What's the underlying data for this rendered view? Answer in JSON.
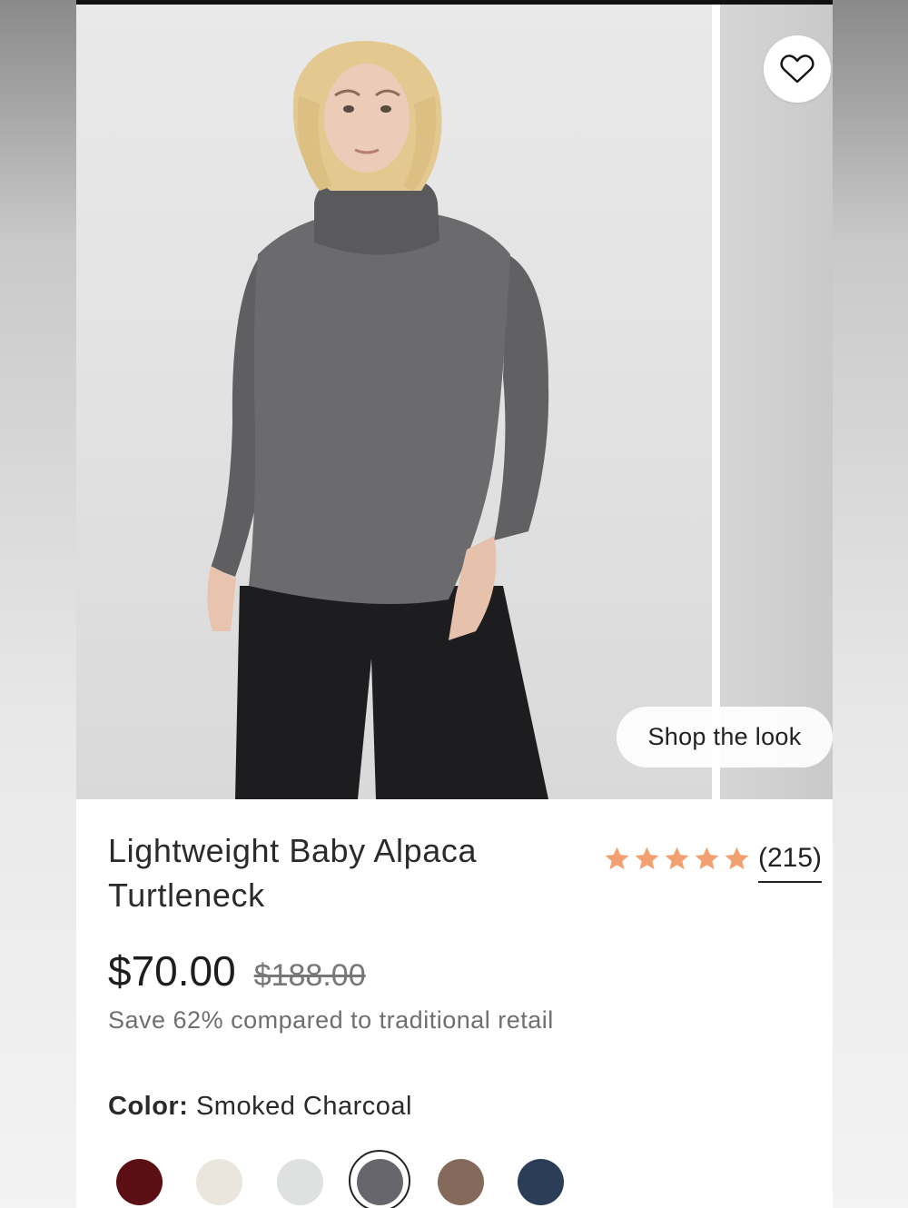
{
  "product": {
    "title": "Lightweight Baby Alpaca Turtleneck",
    "price": "$70.00",
    "original_price": "$188.00",
    "savings_text": "Save 62% compared to traditional retail",
    "rating": 5,
    "review_count": "(215)",
    "color_label": "Color:",
    "color_value": "Smoked Charcoal"
  },
  "gallery": {
    "shop_the_look_label": "Shop the look",
    "favorite_icon": "heart-outline-icon"
  },
  "swatches": [
    {
      "name": "burgundy",
      "color": "#5b0f14",
      "selected": false
    },
    {
      "name": "ivory",
      "color": "#ebe6dd",
      "selected": false
    },
    {
      "name": "light-gray",
      "color": "#dfe0e0",
      "selected": false
    },
    {
      "name": "smoked-charcoal",
      "color": "#66666c",
      "selected": true
    },
    {
      "name": "mocha",
      "color": "#85695a",
      "selected": false
    },
    {
      "name": "navy",
      "color": "#2c3e57",
      "selected": false
    }
  ],
  "colors": {
    "star": "#f2a06f",
    "text_dark": "#2b2b2b",
    "text_muted": "#6f6f6f"
  }
}
